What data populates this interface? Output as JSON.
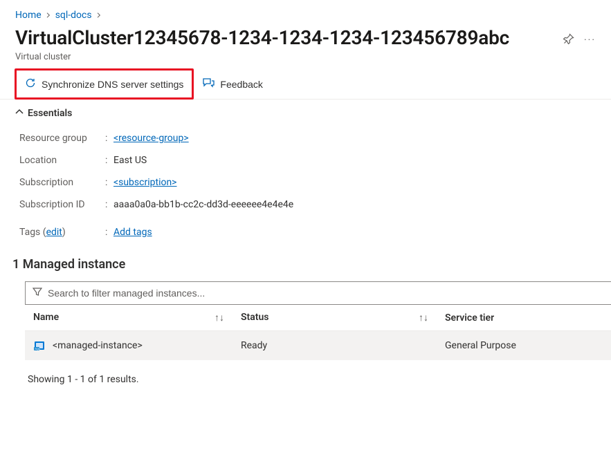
{
  "breadcrumb": {
    "home": "Home",
    "parent": "sql-docs"
  },
  "page": {
    "title": "VirtualCluster12345678-1234-1234-1234-123456789abc",
    "subtitle": "Virtual cluster"
  },
  "commands": {
    "sync_dns": "Synchronize DNS server settings",
    "feedback": "Feedback"
  },
  "essentials": {
    "heading": "Essentials",
    "rows": {
      "resource_group": {
        "label": "Resource group",
        "value": "<resource-group>",
        "link": true
      },
      "location": {
        "label": "Location",
        "value": "East US",
        "link": false
      },
      "subscription": {
        "label": "Subscription",
        "value": "<subscription>",
        "link": true
      },
      "subscription_id": {
        "label": "Subscription ID",
        "value": "aaaa0a0a-bb1b-cc2c-dd3d-eeeeee4e4e4e",
        "link": false
      }
    },
    "tags": {
      "label": "Tags",
      "edit": "edit",
      "add": "Add tags"
    }
  },
  "managed_instances": {
    "heading": "1 Managed instance",
    "search_placeholder": "Search to filter managed instances...",
    "columns": {
      "name": "Name",
      "status": "Status",
      "tier": "Service tier"
    },
    "rows": [
      {
        "name": "<managed-instance>",
        "status": "Ready",
        "tier": "General Purpose"
      }
    ],
    "result_text": "Showing 1 - 1 of 1 results."
  }
}
